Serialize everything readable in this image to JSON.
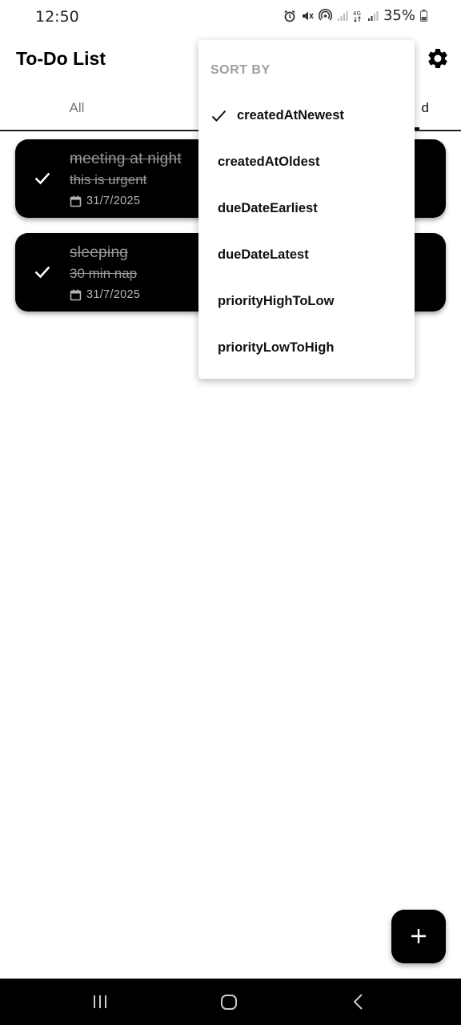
{
  "status_bar": {
    "time": "12:50",
    "battery": "35%"
  },
  "app": {
    "title": "To-Do List"
  },
  "tabs": {
    "all": "All",
    "completed_visible": "d"
  },
  "tasks": [
    {
      "title": "meeting at night",
      "description": "this is urgent",
      "due_date": "31/7/2025",
      "completed": true
    },
    {
      "title": "sleeping",
      "description": "30 min nap",
      "due_date": "31/7/2025",
      "completed": true
    }
  ],
  "sort_menu": {
    "header": "SORT BY",
    "selected": "createdAtNewest",
    "options": [
      "createdAtNewest",
      "createdAtOldest",
      "dueDateEarliest",
      "dueDateLatest",
      "priorityHighToLow",
      "priorityLowToHigh"
    ]
  },
  "icons": {
    "settings": "gear-icon",
    "check": "check-icon",
    "calendar": "calendar-icon",
    "add": "plus-icon"
  },
  "colors": {
    "card_bg": "#000000",
    "muted_text": "#9a9a9a",
    "accent": "#000000"
  }
}
